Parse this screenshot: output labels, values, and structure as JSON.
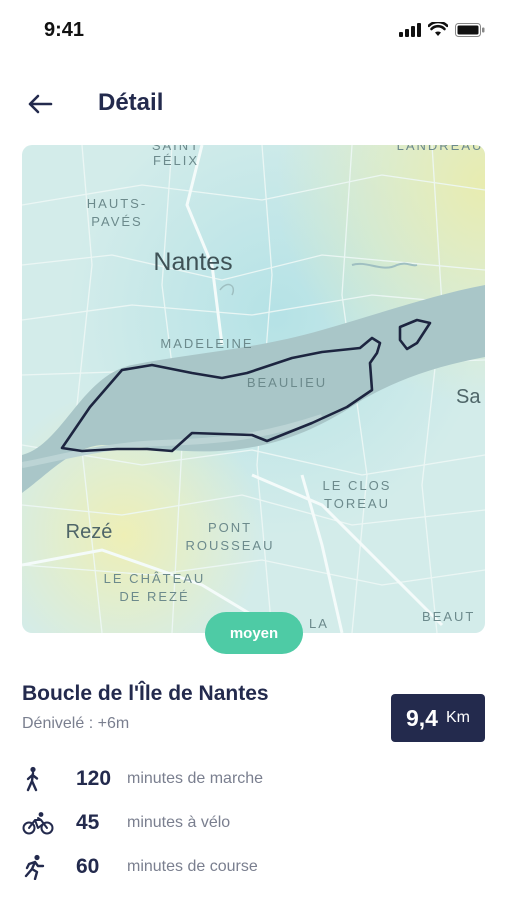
{
  "status_bar": {
    "time": "9:41",
    "icons": [
      "signal-icon",
      "wifi-icon",
      "battery-icon"
    ]
  },
  "header": {
    "back_icon": "arrow-left-icon",
    "title": "Détail"
  },
  "map": {
    "labels": {
      "saint": "SAINT",
      "felix": "FÉLIX",
      "landreau": "LANDREAU",
      "hauts_paves": "HAUTS-\nPAVÉS",
      "nantes": "Nantes",
      "madeleine": "MADELEINE",
      "beaulieu": "BEAULIEU",
      "sa": "Sa",
      "le_clos_toreau": "LE CLOS\nTOREAU",
      "reze": "Rezé",
      "pont_rousseau": "PONT\nROUSSEAU",
      "le_chateau_de_reze": "LE CHÂTEAU\nDE REZÉ",
      "la": "LA",
      "beaut": "BEAUT"
    }
  },
  "difficulty": "moyen",
  "route": {
    "name": "Boucle de l'Île de Nantes",
    "elevation": "Dénivelé : +6m"
  },
  "distance": {
    "value": "9,4",
    "unit": "Km"
  },
  "activities": [
    {
      "icon": "walking-icon",
      "value": "120",
      "label": "minutes de marche"
    },
    {
      "icon": "bike-icon",
      "value": "45",
      "label": "minutes à vélo"
    },
    {
      "icon": "running-icon",
      "value": "60",
      "label": "minutes de course"
    }
  ],
  "colors": {
    "primary": "#232a4d",
    "accent": "#4ecba5",
    "muted": "#7a7f8f"
  }
}
